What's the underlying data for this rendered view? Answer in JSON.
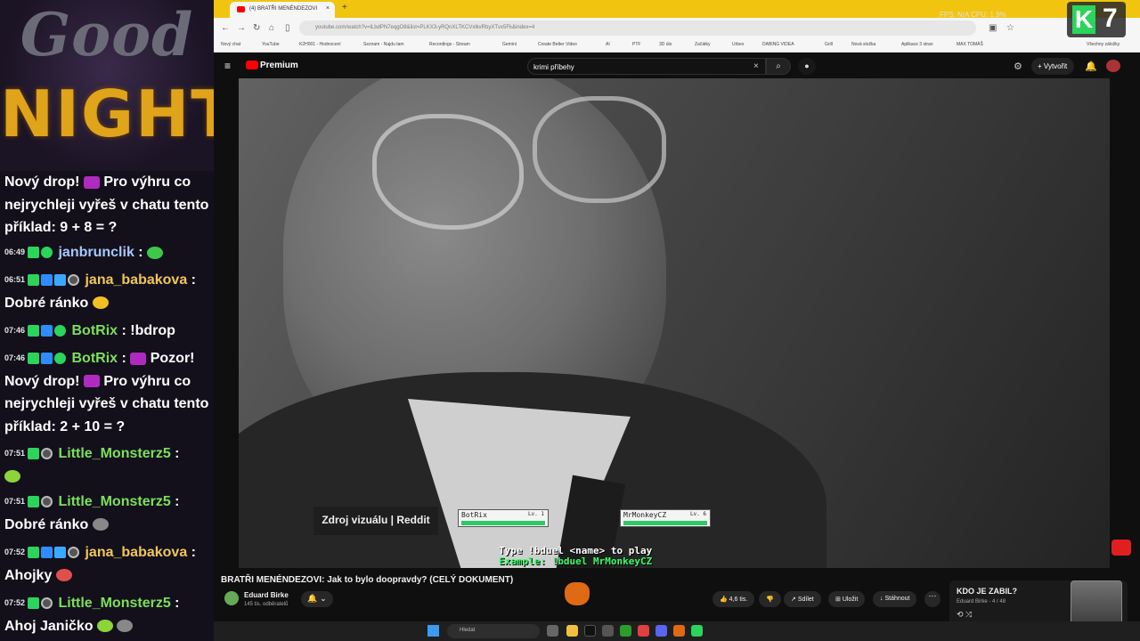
{
  "overlay": {
    "good": "Good",
    "night": "NIGHT"
  },
  "chat": {
    "messages": [
      {
        "time": "",
        "user": "",
        "text": "Nový drop! ",
        "text2": "Pro výhru co nejrychleji vyřeš v chatu tento příklad: 9 + 8 = ?"
      },
      {
        "time": "06:49",
        "user": "janbrunclik",
        "text": " :"
      },
      {
        "time": "06:51",
        "user": "jana_babakova",
        "text": " :",
        "line2": "Dobré ránko"
      },
      {
        "time": "07:46",
        "user": "BotRix",
        "text": " : !bdrop"
      },
      {
        "time": "07:46",
        "user": "BotRix",
        "text": " : ",
        "text_bold": "Pozor!",
        "line2": "Nový drop! ",
        "text2": "Pro výhru co nejrychleji vyřeš v chatu tento příklad: 2 + 10 = ?"
      },
      {
        "time": "07:51",
        "user": "Little_Monsterz5",
        "text": " :"
      },
      {
        "time": "07:51",
        "user": "Little_Monsterz5",
        "text": " :",
        "line2": "Dobré ránko"
      },
      {
        "time": "07:52",
        "user": "jana_babakova",
        "text": " :",
        "line2": "Ahojky"
      },
      {
        "time": "07:52",
        "user": "Little_Monsterz5",
        "text": " :",
        "line2": "Ahoj Janičko"
      }
    ]
  },
  "browser": {
    "tab_title": "(4) BRATŘI MENÉNDEZOVI",
    "tab_close": "×",
    "new_tab": "+",
    "stats": "FPS: N/A    CPU: 1.9%",
    "url": "youtube.com/watch?v=lLbdPN7eqgO8&list=PLKX3-yRQnXLTKCVxlkvRbyXTvx5Fk&index=4",
    "bookmarks": [
      "Nový chat",
      "YouTube",
      "K2H001 - Hodnocení",
      "Seznam - Najdu tam",
      "Recordings - Stream",
      "Gemini",
      "Create Better Video",
      "AI",
      "PTF",
      "3D úlo",
      "Začátky",
      "Urbex",
      "DABING VIDEA",
      "Grill",
      "Nová složka",
      "Aplikace 3 stran",
      "MAX TOMÁŠ",
      "Všechny záložky"
    ]
  },
  "youtube": {
    "premium": "Premium",
    "premium_badge": "CZ",
    "search_query": "krimi příbehy",
    "search_clear": "×",
    "create_label": "Vytvořit",
    "bell_badge": "9+",
    "video_title": "BRATŘI MENÉNDEZOVI: Jak to bylo doopravdy? (CELÝ DOKUMENT)",
    "channel_name": "Eduard Birke",
    "channel_subs": "145 tis. odběratelů",
    "likes": "4,6 tis.",
    "share": "Sdílet",
    "save": "Uložit",
    "download": "Stáhnout",
    "more": "⋯",
    "playlist_title": "KDO JE ZABIL?",
    "playlist_sub": "Eduard Birke - 4 / 48"
  },
  "video_overlay": {
    "source_label": "Zdroj vizuálu | Reddit",
    "player1_name": "BotRix",
    "player1_level": "Lv. 1",
    "player1_hp": 1.0,
    "player2_name": "MrMonkeyCZ",
    "player2_level": "Lv. 6",
    "player2_hp": 1.0,
    "duel_line1": "Type !bduel <name> to play",
    "duel_line2": "Example: !bduel MrMonkeyCZ"
  },
  "taskbar": {
    "search_placeholder": "Hledat"
  },
  "logo": {
    "k": "K",
    "num": "7"
  }
}
